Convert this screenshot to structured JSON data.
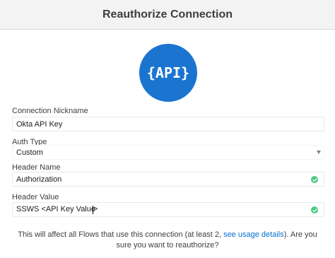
{
  "header": {
    "title": "Reauthorize Connection"
  },
  "logo": {
    "text": "{API}",
    "icon": "api-logo-icon",
    "color": "#1b75d0"
  },
  "form": {
    "nickname": {
      "label": "Connection Nickname",
      "value": "Okta API Key"
    },
    "auth_type": {
      "label": "Auth Type",
      "value": "Custom"
    },
    "header_name": {
      "label": "Header Name",
      "value": "Authorization",
      "status_icon": "check-circle-icon"
    },
    "header_value": {
      "label": "Header Value",
      "value_before_cursor": "SSWS <API Key Value",
      "value_after_cursor": ">",
      "status_icon": "check-circle-icon"
    }
  },
  "message": {
    "text_before": "This will affect all Flows that use this connection (at least 2, ",
    "link": "see usage details",
    "text_after": "). Are you sure you want to reauthorize?"
  },
  "colors": {
    "accent": "#0070d2",
    "success": "#4bca81"
  }
}
